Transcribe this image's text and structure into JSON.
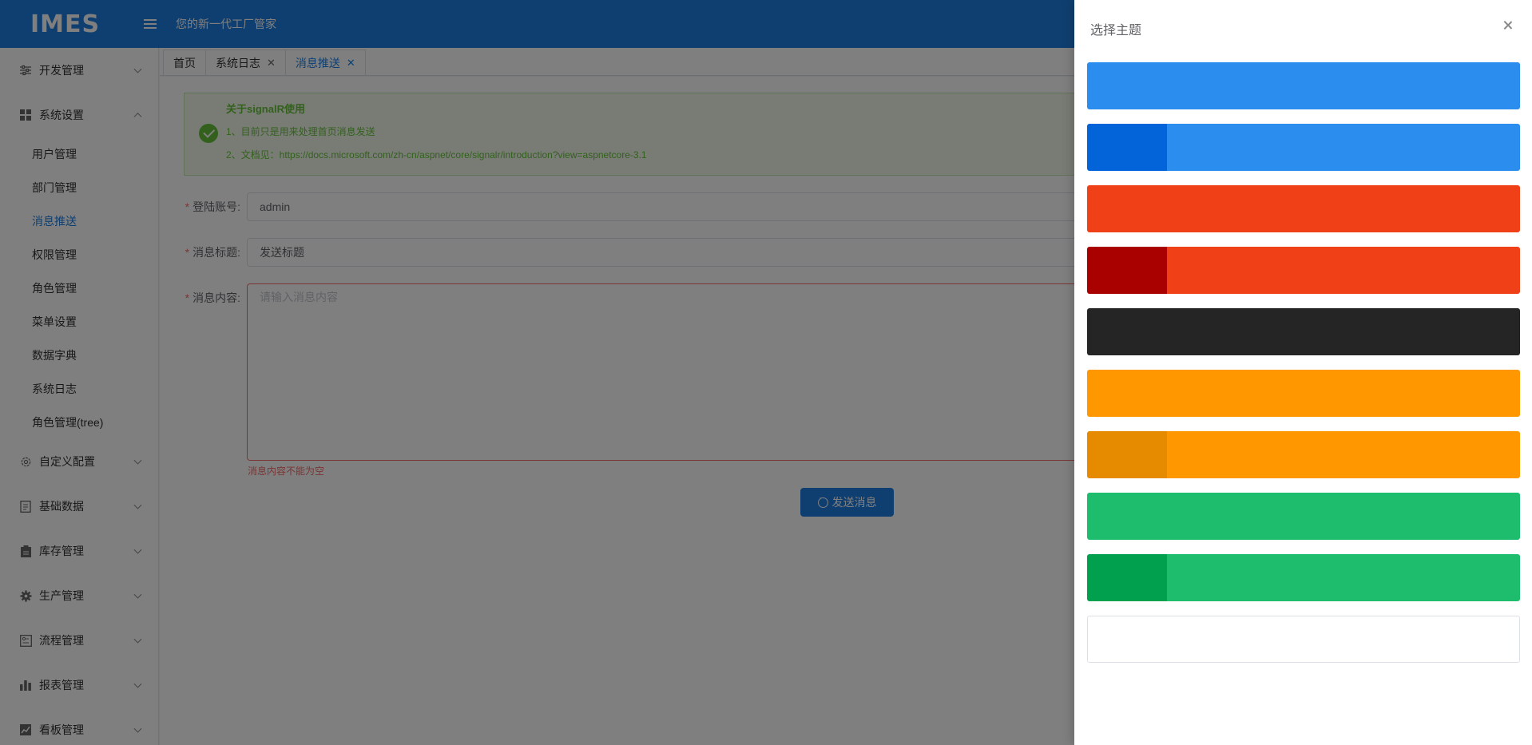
{
  "header": {
    "logo": "IMES",
    "slogan": "您的新一代工厂管家"
  },
  "sidebar": {
    "groups": [
      {
        "label": "开发管理",
        "icon": "sliders-icon",
        "expanded": false
      },
      {
        "label": "系统设置",
        "icon": "grid-icon",
        "expanded": true
      }
    ],
    "sub_items": [
      "用户管理",
      "部门管理",
      "消息推送",
      "权限管理",
      "角色管理",
      "菜单设置",
      "数据字典",
      "系统日志",
      "角色管理(tree)"
    ],
    "active_sub": "消息推送",
    "groups_after": [
      {
        "label": "自定义配置",
        "icon": "gear-icon"
      },
      {
        "label": "基础数据",
        "icon": "document-icon"
      },
      {
        "label": "库存管理",
        "icon": "clipboard-icon"
      },
      {
        "label": "生产管理",
        "icon": "cog-icon"
      },
      {
        "label": "流程管理",
        "icon": "flow-icon"
      },
      {
        "label": "报表管理",
        "icon": "bar-chart-icon"
      },
      {
        "label": "看板管理",
        "icon": "trend-chart-icon"
      }
    ]
  },
  "tabs": [
    {
      "label": "首页",
      "closable": false
    },
    {
      "label": "系统日志",
      "closable": true
    },
    {
      "label": "消息推送",
      "closable": true,
      "active": true
    }
  ],
  "alert": {
    "title": "关于signalR使用",
    "line1": "1、目前只是用来处理首页消息发送",
    "line2": "2、文档见：https://docs.microsoft.com/zh-cn/aspnet/core/signalr/introduction?view=aspnetcore-3.1"
  },
  "form": {
    "account_label": "登陆账号:",
    "account_value": "admin",
    "title_label": "消息标题:",
    "title_value": "发送标题",
    "content_label": "消息内容:",
    "content_placeholder": "请输入消息内容",
    "content_error": "消息内容不能为空",
    "required_mark": "*",
    "send_button": "发送消息"
  },
  "drawer": {
    "title": "选择主题",
    "themes": [
      {
        "left": "#2b8eee",
        "right": "#2b8eee"
      },
      {
        "left": "#0363d8",
        "right": "#2b8eee"
      },
      {
        "left": "#ef4018",
        "right": "#ef4018"
      },
      {
        "left": "#a90000",
        "right": "#ef4018"
      },
      {
        "left": "#252525",
        "right": "#252525"
      },
      {
        "left": "#ff9800",
        "right": "#ff9800"
      },
      {
        "left": "#e68a00",
        "right": "#ff9800"
      },
      {
        "left": "#1ebd6d",
        "right": "#1ebd6d"
      },
      {
        "left": "#00a04f",
        "right": "#1ebd6d"
      },
      {
        "left": "#ffffff",
        "right": "#ffffff"
      }
    ]
  }
}
